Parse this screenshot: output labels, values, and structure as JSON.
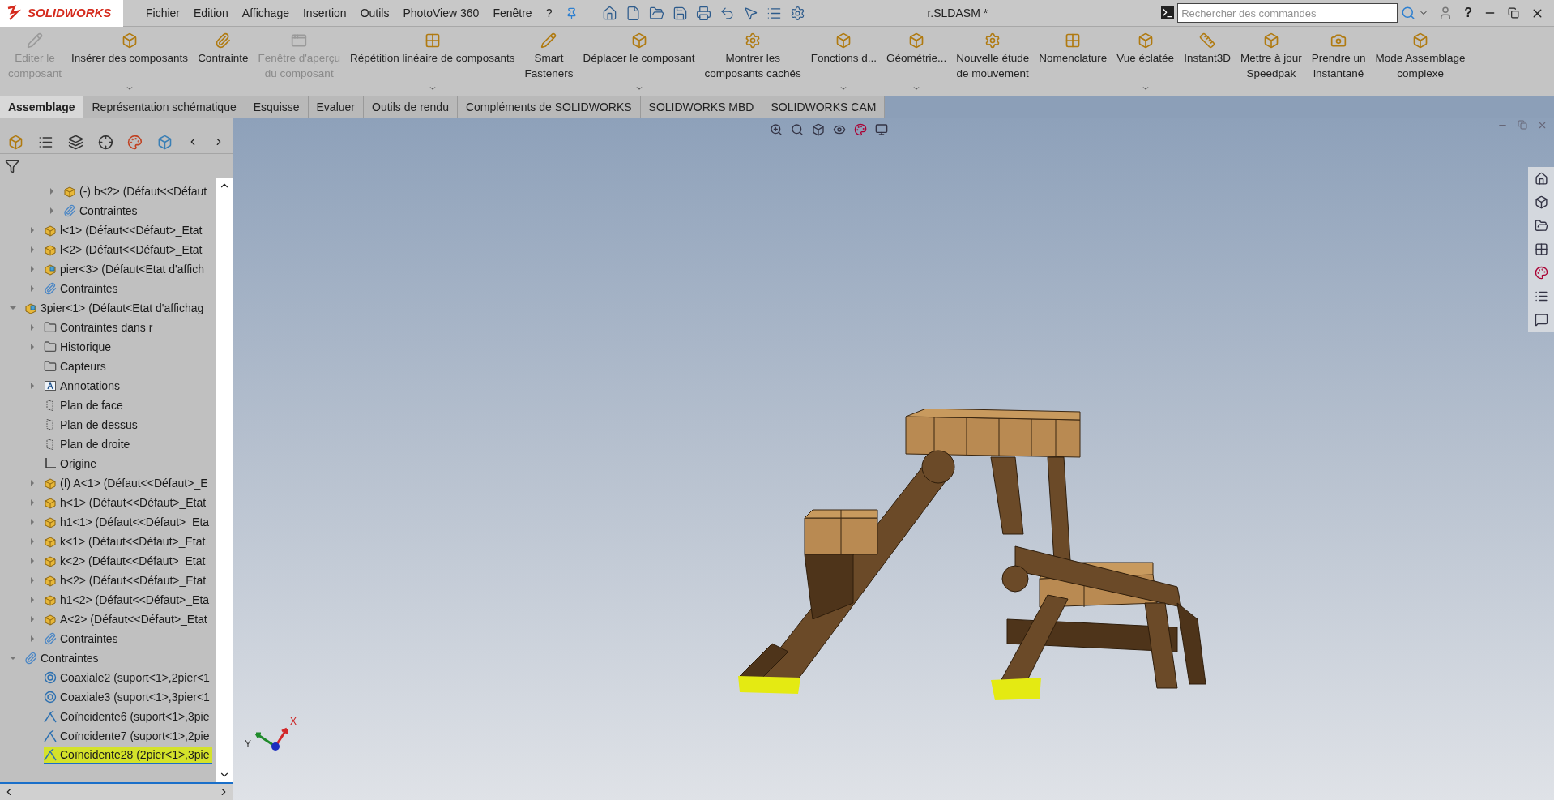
{
  "app": {
    "logo": "SOLIDWORKS",
    "title": "r.SLDASM *"
  },
  "menu": [
    "Fichier",
    "Edition",
    "Affichage",
    "Insertion",
    "Outils",
    "PhotoView 360",
    "Fenêtre",
    "?"
  ],
  "search": {
    "placeholder": "Rechercher des commandes"
  },
  "help_label": "?",
  "ribbon": [
    {
      "label": "Editer le\ncomposant",
      "kind": "pencil",
      "disabled": true,
      "dropdown": false
    },
    {
      "label": "Insérer des composants",
      "kind": "cube",
      "disabled": false,
      "dropdown": true
    },
    {
      "label": "Contrainte",
      "kind": "clip",
      "disabled": false,
      "dropdown": false
    },
    {
      "label": "Fenêtre d'aperçu\ndu composant",
      "kind": "window",
      "disabled": true,
      "dropdown": false
    },
    {
      "label": "Répétition linéaire de composants",
      "kind": "grid",
      "disabled": false,
      "dropdown": true
    },
    {
      "label": "Smart\nFasteners",
      "kind": "pencil",
      "disabled": false,
      "dropdown": false
    },
    {
      "label": "Déplacer le composant",
      "kind": "cube",
      "disabled": false,
      "dropdown": true
    },
    {
      "label": "Montrer les\ncomposants cachés",
      "kind": "gear",
      "disabled": false,
      "dropdown": false
    },
    {
      "label": "Fonctions d...",
      "kind": "cube",
      "disabled": false,
      "dropdown": true
    },
    {
      "label": "Géométrie...",
      "kind": "cube",
      "disabled": false,
      "dropdown": true
    },
    {
      "label": "Nouvelle étude\nde mouvement",
      "kind": "gear",
      "disabled": false,
      "dropdown": false
    },
    {
      "label": "Nomenclature",
      "kind": "grid",
      "disabled": false,
      "dropdown": false
    },
    {
      "label": "Vue éclatée",
      "kind": "cube",
      "disabled": false,
      "dropdown": true
    },
    {
      "label": "Instant3D",
      "kind": "ruler",
      "disabled": false,
      "dropdown": false
    },
    {
      "label": "Mettre à jour\nSpeedpak",
      "kind": "cube",
      "disabled": false,
      "dropdown": false
    },
    {
      "label": "Prendre un\ninstantané",
      "kind": "camera",
      "disabled": false,
      "dropdown": false
    },
    {
      "label": "Mode Assemblage\ncomplexe",
      "kind": "cube",
      "disabled": false,
      "dropdown": false
    }
  ],
  "tabs": [
    {
      "label": "Assemblage",
      "selected": true
    },
    {
      "label": "Représentation schématique",
      "selected": false
    },
    {
      "label": "Esquisse",
      "selected": false
    },
    {
      "label": "Evaluer",
      "selected": false
    },
    {
      "label": "Outils de rendu",
      "selected": false
    },
    {
      "label": "Compléments de SOLIDWORKS",
      "selected": false
    },
    {
      "label": "SOLIDWORKS MBD",
      "selected": false
    },
    {
      "label": "SOLIDWORKS CAM",
      "selected": false
    }
  ],
  "tree": [
    {
      "children": [
        {
          "children": [
            {
              "label": "(-) b<2> (Défaut<<Défaut",
              "kind": "part",
              "expandable": true,
              "expanded": false,
              "selected": false
            },
            {
              "label": "Contraintes",
              "kind": "mates",
              "expandable": true,
              "expanded": false,
              "selected": false
            }
          ]
        },
        {
          "label": "l<1> (Défaut<<Défaut>_Etat",
          "kind": "part",
          "expandable": true,
          "expanded": false,
          "selected": false
        },
        {
          "label": "l<2> (Défaut<<Défaut>_Etat",
          "kind": "part",
          "expandable": true,
          "expanded": false,
          "selected": false
        },
        {
          "label": "pier<3> (Défaut<Etat d'affich",
          "kind": "assembly",
          "expandable": true,
          "expanded": false,
          "selected": false
        },
        {
          "label": "Contraintes",
          "kind": "mates",
          "expandable": true,
          "expanded": false,
          "selected": false
        }
      ]
    },
    {
      "label": "3pier<1> (Défaut<Etat d'affichag",
      "kind": "assembly",
      "expandable": true,
      "expanded": true,
      "selected": false,
      "children": [
        {
          "label": "Contraintes dans r",
          "kind": "folder",
          "expandable": true,
          "expanded": false,
          "selected": false
        },
        {
          "label": "Historique",
          "kind": "folder",
          "expandable": true,
          "expanded": false,
          "selected": false
        },
        {
          "label": "Capteurs",
          "kind": "folder",
          "expandable": false,
          "selected": false
        },
        {
          "label": "Annotations",
          "kind": "annotation",
          "expandable": true,
          "expanded": false,
          "selected": false
        },
        {
          "label": "Plan de face",
          "kind": "plane",
          "expandable": false,
          "selected": false
        },
        {
          "label": "Plan de dessus",
          "kind": "plane",
          "expandable": false,
          "selected": false
        },
        {
          "label": "Plan de droite",
          "kind": "plane",
          "expandable": false,
          "selected": false
        },
        {
          "label": "Origine",
          "kind": "origin",
          "expandable": false,
          "selected": false
        },
        {
          "label": "(f) A<1> (Défaut<<Défaut>_E",
          "kind": "part",
          "expandable": true,
          "expanded": false,
          "selected": false
        },
        {
          "label": "h<1> (Défaut<<Défaut>_Etat",
          "kind": "part",
          "expandable": true,
          "expanded": false,
          "selected": false
        },
        {
          "label": "h1<1> (Défaut<<Défaut>_Eta",
          "kind": "part",
          "expandable": true,
          "expanded": false,
          "selected": false
        },
        {
          "label": "k<1> (Défaut<<Défaut>_Etat",
          "kind": "part",
          "expandable": true,
          "expanded": false,
          "selected": false
        },
        {
          "label": "k<2> (Défaut<<Défaut>_Etat",
          "kind": "part",
          "expandable": true,
          "expanded": false,
          "selected": false
        },
        {
          "label": "h<2> (Défaut<<Défaut>_Etat",
          "kind": "part",
          "expandable": true,
          "expanded": false,
          "selected": false
        },
        {
          "label": "h1<2> (Défaut<<Défaut>_Eta",
          "kind": "part",
          "expandable": true,
          "expanded": false,
          "selected": false
        },
        {
          "label": "A<2> (Défaut<<Défaut>_Etat",
          "kind": "part",
          "expandable": true,
          "expanded": false,
          "selected": false
        },
        {
          "label": "Contraintes",
          "kind": "mates",
          "expandable": true,
          "expanded": false,
          "selected": false
        }
      ]
    },
    {
      "label": "Contraintes",
      "kind": "mates",
      "expandable": true,
      "expanded": true,
      "selected": false,
      "children": [
        {
          "label": "Coaxiale2 (suport<1>,2pier<1",
          "kind": "coaxial",
          "expandable": false,
          "selected": false
        },
        {
          "label": "Coaxiale3 (suport<1>,3pier<1",
          "kind": "coaxial",
          "expandable": false,
          "selected": false
        },
        {
          "label": "Coïncidente6 (suport<1>,3pie",
          "kind": "coincident",
          "expandable": false,
          "selected": false
        },
        {
          "label": "Coïncidente7 (suport<1>,2pie",
          "kind": "coincident",
          "expandable": false,
          "selected": false
        },
        {
          "label": "Coïncidente28 (2pier<1>,3pie",
          "kind": "coincident",
          "expandable": false,
          "selected": true
        }
      ]
    }
  ],
  "triad": {
    "x_label": "X",
    "y_label": "Y"
  }
}
